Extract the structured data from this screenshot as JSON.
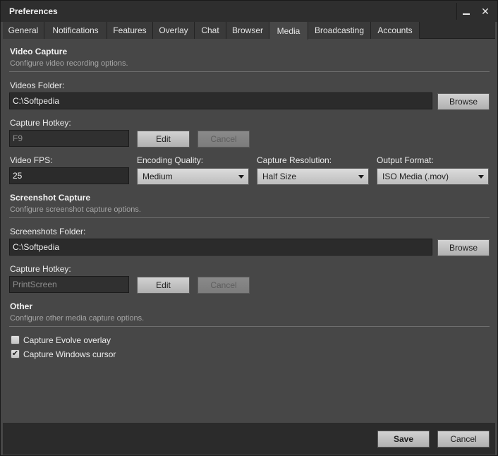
{
  "window": {
    "title": "Preferences"
  },
  "tabs": [
    {
      "label": "General"
    },
    {
      "label": "Notifications"
    },
    {
      "label": "Features"
    },
    {
      "label": "Overlay"
    },
    {
      "label": "Chat"
    },
    {
      "label": "Browser"
    },
    {
      "label": "Media"
    },
    {
      "label": "Broadcasting"
    },
    {
      "label": "Accounts"
    }
  ],
  "active_tab": "Media",
  "video": {
    "title": "Video Capture",
    "subtitle": "Configure video recording options.",
    "folder_label": "Videos Folder:",
    "folder_value": "C:\\Softpedia",
    "browse_label": "Browse",
    "hotkey_label": "Capture Hotkey:",
    "hotkey_value": "F9",
    "edit_label": "Edit",
    "cancel_label": "Cancel",
    "fps_label": "Video FPS:",
    "fps_value": "25",
    "quality_label": "Encoding Quality:",
    "quality_value": "Medium",
    "resolution_label": "Capture Resolution:",
    "resolution_value": "Half Size",
    "format_label": "Output Format:",
    "format_value": "ISO Media (.mov)"
  },
  "screenshot": {
    "title": "Screenshot Capture",
    "subtitle": "Configure screenshot capture options.",
    "folder_label": "Screenshots Folder:",
    "folder_value": "C:\\Softpedia",
    "browse_label": "Browse",
    "hotkey_label": "Capture Hotkey:",
    "hotkey_value": "PrintScreen",
    "edit_label": "Edit",
    "cancel_label": "Cancel"
  },
  "other": {
    "title": "Other",
    "subtitle": "Configure other media capture options.",
    "options": [
      {
        "label": "Capture Evolve overlay",
        "checked": false
      },
      {
        "label": "Capture Windows cursor",
        "checked": true
      }
    ]
  },
  "footer": {
    "save_label": "Save",
    "cancel_label": "Cancel"
  }
}
